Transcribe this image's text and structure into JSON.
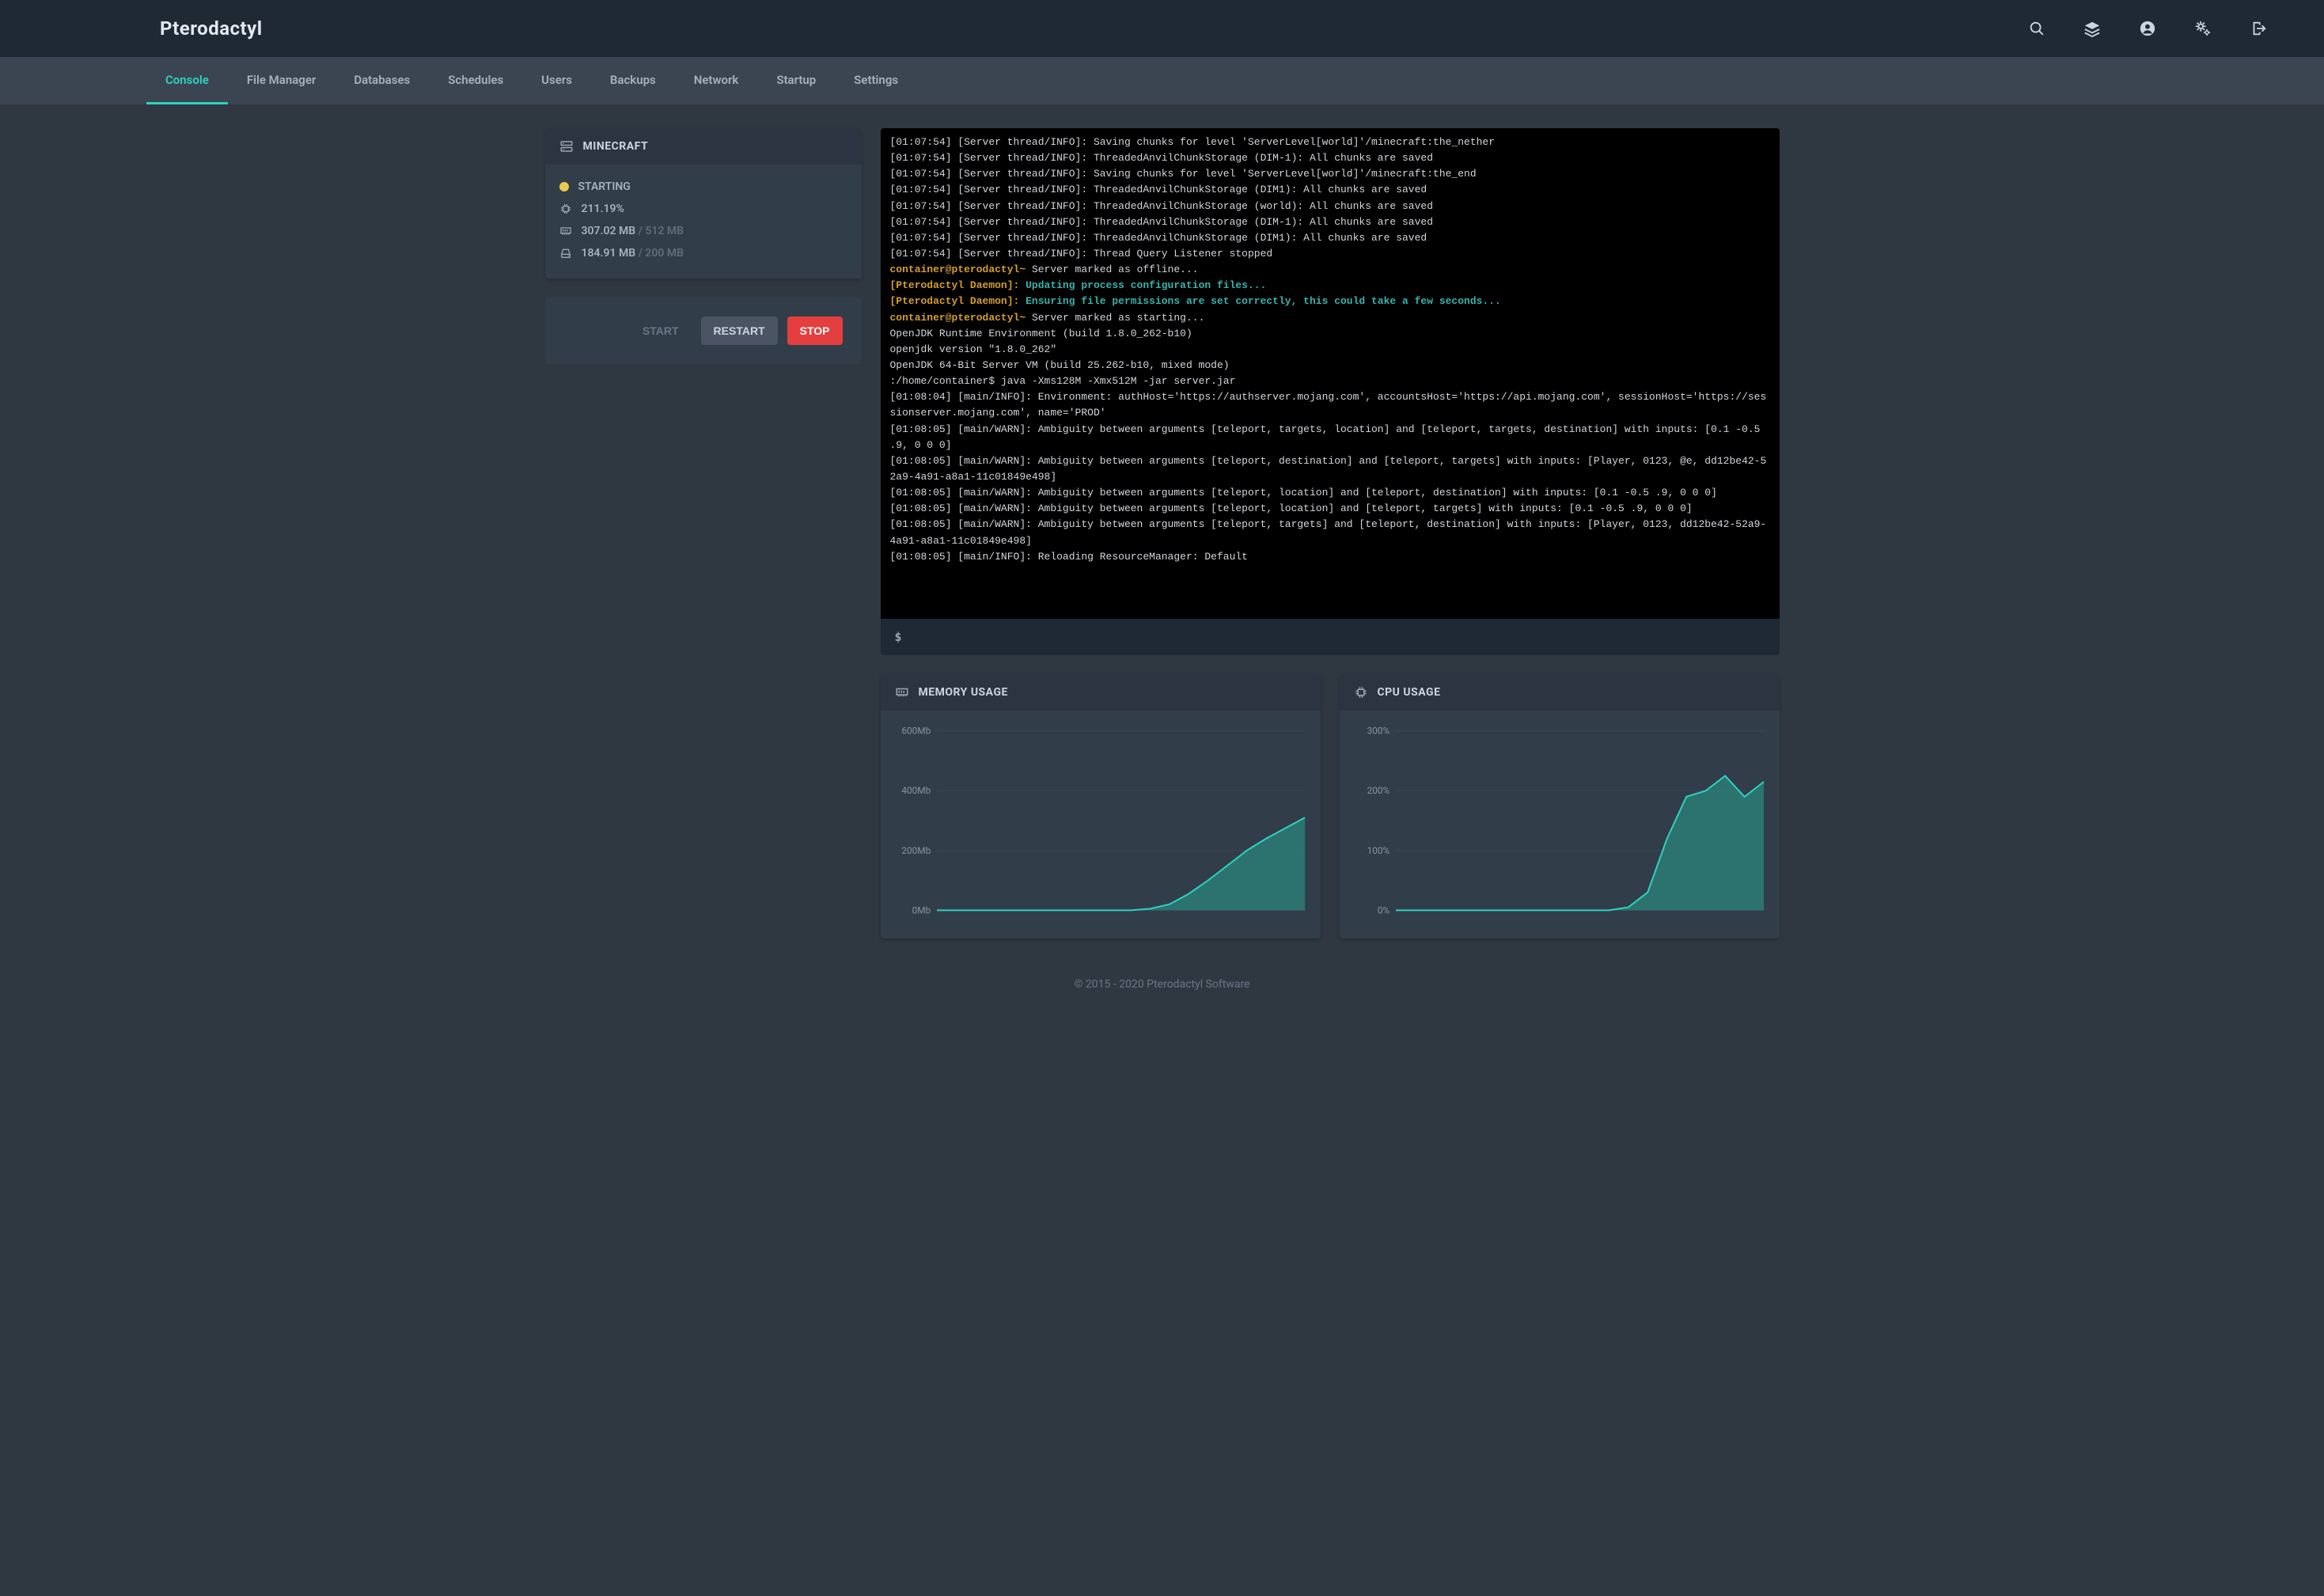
{
  "brand": "Pterodactyl",
  "header_icons": [
    "search",
    "layers",
    "user-circle",
    "cogs",
    "sign-out"
  ],
  "tabs": [
    {
      "label": "Console",
      "active": true
    },
    {
      "label": "File Manager",
      "active": false
    },
    {
      "label": "Databases",
      "active": false
    },
    {
      "label": "Schedules",
      "active": false
    },
    {
      "label": "Users",
      "active": false
    },
    {
      "label": "Backups",
      "active": false
    },
    {
      "label": "Network",
      "active": false
    },
    {
      "label": "Startup",
      "active": false
    },
    {
      "label": "Settings",
      "active": false
    }
  ],
  "server": {
    "name": "MINECRAFT",
    "status": "STARTING",
    "status_color": "#ecc94b",
    "cpu_pct": "211.19%",
    "mem_used": "307.02 MB",
    "mem_total": " / 512 MB",
    "disk_used": "184.91 MB",
    "disk_total": " / 200 MB"
  },
  "power_buttons": {
    "start": "START",
    "restart": "RESTART",
    "stop": "STOP"
  },
  "command_prompt": "$",
  "console_lines": [
    {
      "t": "[01:07:54] [Server thread/INFO]: Saving chunks for level 'ServerLevel[world]'/minecraft:the_nether"
    },
    {
      "t": "[01:07:54] [Server thread/INFO]: ThreadedAnvilChunkStorage (DIM-1): All chunks are saved"
    },
    {
      "t": "[01:07:54] [Server thread/INFO]: Saving chunks for level 'ServerLevel[world]'/minecraft:the_end"
    },
    {
      "t": "[01:07:54] [Server thread/INFO]: ThreadedAnvilChunkStorage (DIM1): All chunks are saved"
    },
    {
      "t": "[01:07:54] [Server thread/INFO]: ThreadedAnvilChunkStorage (world): All chunks are saved"
    },
    {
      "t": "[01:07:54] [Server thread/INFO]: ThreadedAnvilChunkStorage (DIM-1): All chunks are saved"
    },
    {
      "t": "[01:07:54] [Server thread/INFO]: ThreadedAnvilChunkStorage (DIM1): All chunks are saved"
    },
    {
      "t": "[01:07:54] [Server thread/INFO]: Thread Query Listener stopped"
    },
    {
      "pre": "container@pterodactyl~",
      "precls": "yo",
      "t": " Server marked as offline..."
    },
    {
      "pre": "[Pterodactyl Daemon]:",
      "precls": "yo",
      "post": " Updating process configuration files...",
      "postcls": "cy"
    },
    {
      "pre": "[Pterodactyl Daemon]:",
      "precls": "yo",
      "post": " Ensuring file permissions are set correctly, this could take a few seconds...",
      "postcls": "cy"
    },
    {
      "pre": "container@pterodactyl~",
      "precls": "yo",
      "t": " Server marked as starting..."
    },
    {
      "t": "OpenJDK Runtime Environment (build 1.8.0_262-b10)"
    },
    {
      "t": "openjdk version \"1.8.0_262\""
    },
    {
      "t": "OpenJDK 64-Bit Server VM (build 25.262-b10, mixed mode)"
    },
    {
      "t": ":/home/container$ java -Xms128M -Xmx512M -jar server.jar"
    },
    {
      "t": "[01:08:04] [main/INFO]: Environment: authHost='https://authserver.mojang.com', accountsHost='https://api.mojang.com', sessionHost='https://sessionserver.mojang.com', name='PROD'"
    },
    {
      "t": "[01:08:05] [main/WARN]: Ambiguity between arguments [teleport, targets, location] and [teleport, targets, destination] with inputs: [0.1 -0.5 .9, 0 0 0]"
    },
    {
      "t": "[01:08:05] [main/WARN]: Ambiguity between arguments [teleport, destination] and [teleport, targets] with inputs: [Player, 0123, @e, dd12be42-52a9-4a91-a8a1-11c01849e498]"
    },
    {
      "t": "[01:08:05] [main/WARN]: Ambiguity between arguments [teleport, location] and [teleport, destination] with inputs: [0.1 -0.5 .9, 0 0 0]"
    },
    {
      "t": "[01:08:05] [main/WARN]: Ambiguity between arguments [teleport, location] and [teleport, targets] with inputs: [0.1 -0.5 .9, 0 0 0]"
    },
    {
      "t": "[01:08:05] [main/WARN]: Ambiguity between arguments [teleport, targets] and [teleport, destination] with inputs: [Player, 0123, dd12be42-52a9-4a91-a8a1-11c01849e498]"
    },
    {
      "t": "[01:08:05] [main/INFO]: Reloading ResourceManager: Default"
    }
  ],
  "charts": {
    "memory": {
      "title": "MEMORY USAGE"
    },
    "cpu": {
      "title": "CPU USAGE"
    }
  },
  "chart_data": [
    {
      "id": "memory",
      "type": "area",
      "title": "MEMORY USAGE",
      "ylabel": "Mb",
      "ylim": [
        0,
        600
      ],
      "yticks": [
        0,
        200,
        400,
        600
      ],
      "ytick_labels": [
        "0Mb",
        "200Mb",
        "400Mb",
        "600Mb"
      ],
      "x": [
        0,
        1,
        2,
        3,
        4,
        5,
        6,
        7,
        8,
        9,
        10,
        11,
        12,
        13,
        14,
        15,
        16,
        17,
        18,
        19
      ],
      "values": [
        0,
        0,
        0,
        0,
        0,
        0,
        0,
        0,
        0,
        0,
        0,
        5,
        20,
        55,
        100,
        150,
        200,
        240,
        275,
        310
      ]
    },
    {
      "id": "cpu",
      "type": "area",
      "title": "CPU USAGE",
      "ylabel": "%",
      "ylim": [
        0,
        300
      ],
      "yticks": [
        0,
        100,
        200,
        300
      ],
      "ytick_labels": [
        "0%",
        "100%",
        "200%",
        "300%"
      ],
      "x": [
        0,
        1,
        2,
        3,
        4,
        5,
        6,
        7,
        8,
        9,
        10,
        11,
        12,
        13,
        14,
        15,
        16,
        17,
        18,
        19
      ],
      "values": [
        0,
        0,
        0,
        0,
        0,
        0,
        0,
        0,
        0,
        0,
        0,
        0,
        5,
        30,
        120,
        190,
        200,
        225,
        190,
        215
      ]
    }
  ],
  "footer": "© 2015 - 2020 Pterodactyl Software"
}
